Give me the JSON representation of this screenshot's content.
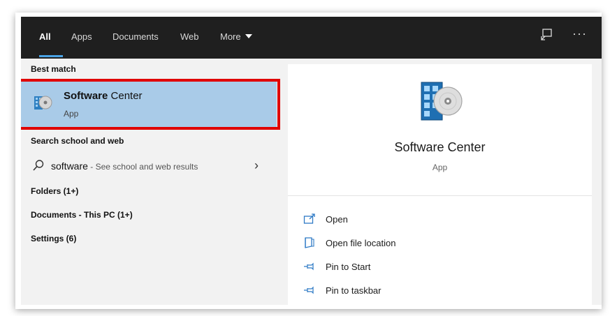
{
  "tabs": [
    {
      "label": "All",
      "active": true
    },
    {
      "label": "Apps"
    },
    {
      "label": "Documents"
    },
    {
      "label": "Web"
    },
    {
      "label": "More"
    }
  ],
  "topbar_icons": [
    "feedback-icon",
    "more-options-icon"
  ],
  "more_options_glyph": "···",
  "left": {
    "best_match_heading": "Best match",
    "best_match": {
      "title_bold": "Software",
      "title_rest": " Center",
      "subtitle": "App",
      "icon": "software-center-icon"
    },
    "search_heading": "Search school and web",
    "search_suggestion": {
      "term": "software",
      "hint": " - See school and web results"
    },
    "categories": [
      "Folders (1+)",
      "Documents - This PC (1+)",
      "Settings (6)"
    ]
  },
  "right": {
    "app_title": "Software Center",
    "app_subtitle": "App",
    "actions": [
      {
        "label": "Open",
        "icon": "open-icon"
      },
      {
        "label": "Open file location",
        "icon": "file-location-icon"
      },
      {
        "label": "Pin to Start",
        "icon": "pin-icon"
      },
      {
        "label": "Pin to taskbar",
        "icon": "pin-icon"
      }
    ]
  },
  "colors": {
    "topbar": "#1f1f1f",
    "selected_item": "#a9cbe8",
    "highlight_border": "#e00000",
    "accent": "#4aa3e6"
  }
}
